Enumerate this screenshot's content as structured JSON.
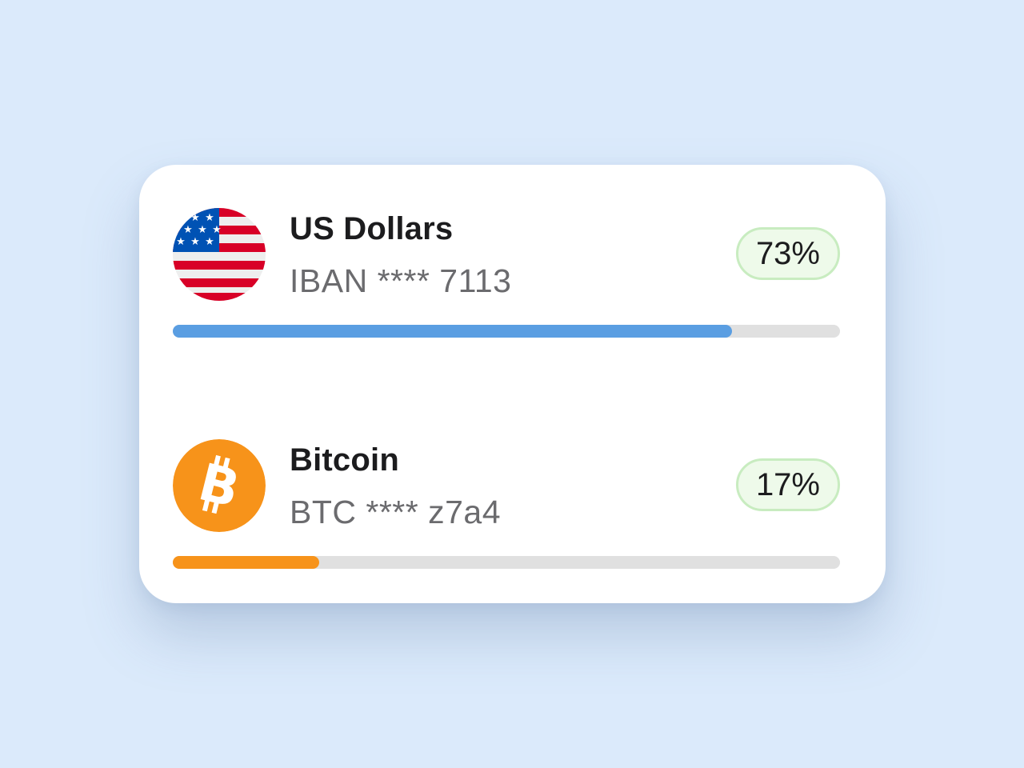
{
  "accounts": [
    {
      "name": "US Dollars",
      "account": "IBAN **** 7113",
      "percent_label": "73%",
      "progress_fraction": 0.838,
      "icon": "us-flag-icon",
      "color": "#5a9ee2"
    },
    {
      "name": "Bitcoin",
      "account": "BTC **** z7a4",
      "percent_label": "17%",
      "progress_fraction": 0.22,
      "icon": "bitcoin-icon",
      "color": "#f7931a"
    }
  ],
  "colors": {
    "background": "#dbeafb",
    "card": "#ffffff",
    "pill_border": "#c8ecc0",
    "pill_background": "#eefaea",
    "track": "#e0e0e0"
  }
}
